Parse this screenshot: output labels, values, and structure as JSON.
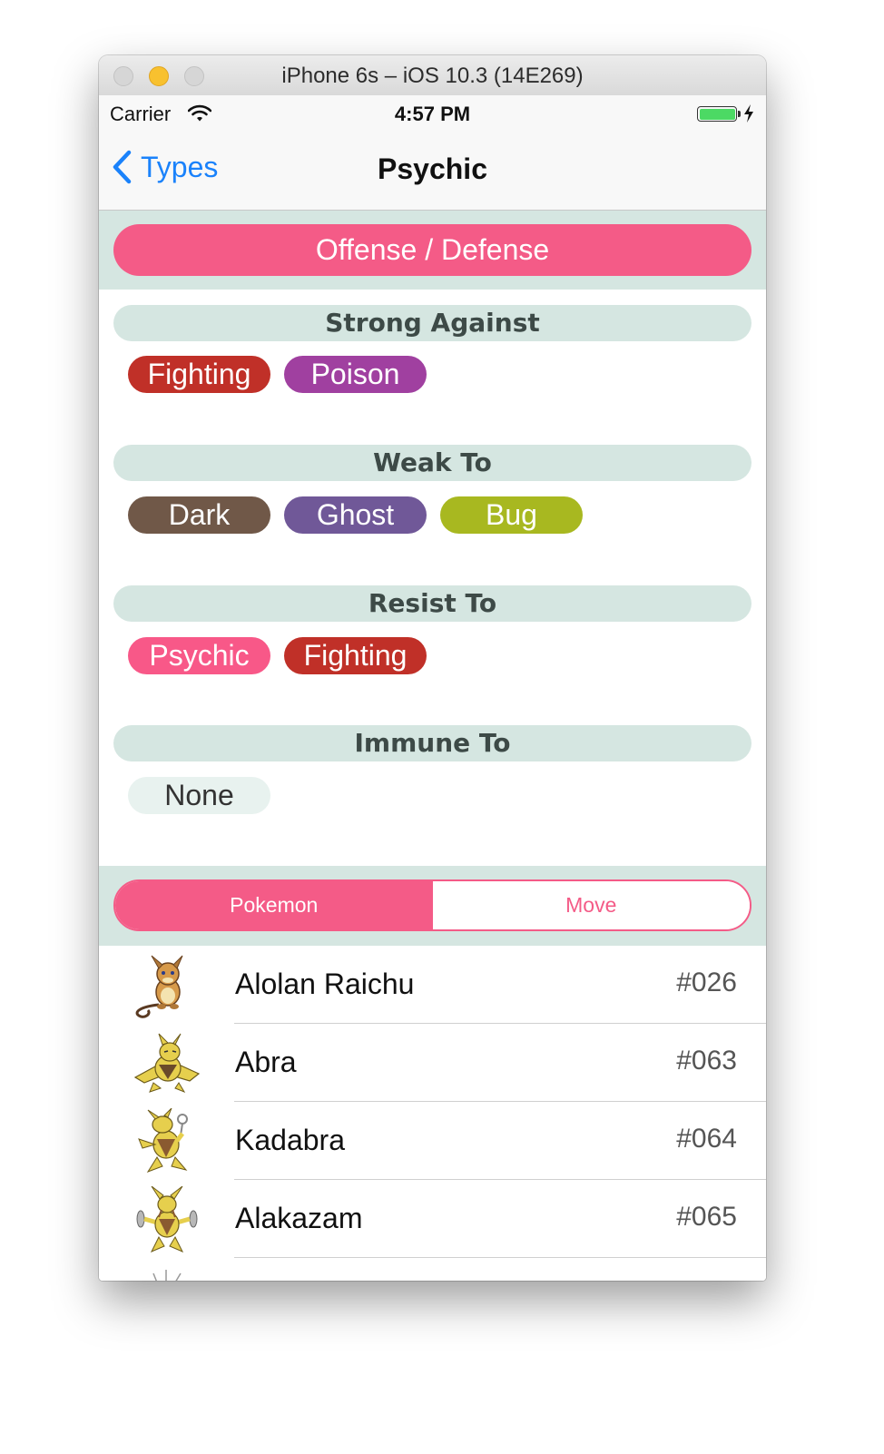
{
  "window": {
    "title": "iPhone 6s – iOS 10.3 (14E269)"
  },
  "status_bar": {
    "carrier": "Carrier",
    "time": "4:57 PM"
  },
  "nav": {
    "back_label": "Types",
    "title": "Psychic"
  },
  "offense_defense": {
    "label": "Offense / Defense"
  },
  "sections": {
    "strong": {
      "header": "Strong Against",
      "types": [
        {
          "label": "Fighting",
          "color": "#c03028"
        },
        {
          "label": "Poison",
          "color": "#a040a0"
        }
      ]
    },
    "weak": {
      "header": "Weak To",
      "types": [
        {
          "label": "Dark",
          "color": "#705848"
        },
        {
          "label": "Ghost",
          "color": "#705898"
        },
        {
          "label": "Bug",
          "color": "#a8b820"
        }
      ]
    },
    "resist": {
      "header": "Resist To",
      "types": [
        {
          "label": "Psychic",
          "color": "#f85888"
        },
        {
          "label": "Fighting",
          "color": "#c03028"
        }
      ]
    },
    "immune": {
      "header": "Immune To",
      "types": [
        {
          "label": "None",
          "color": "#e8f2ef"
        }
      ]
    }
  },
  "segment": {
    "pokemon": "Pokemon",
    "move": "Move",
    "selected": "Pokemon"
  },
  "pokemon_list": [
    {
      "name": "Alolan Raichu",
      "number": "#026",
      "sprite": "alolan-raichu-sprite"
    },
    {
      "name": "Abra",
      "number": "#063",
      "sprite": "abra-sprite"
    },
    {
      "name": "Kadabra",
      "number": "#064",
      "sprite": "kadabra-sprite"
    },
    {
      "name": "Alakazam",
      "number": "#065",
      "sprite": "alakazam-sprite"
    }
  ],
  "colors": {
    "accent": "#f45b87",
    "tint": "#1a82fb",
    "section_bg": "#d5e6e1"
  }
}
